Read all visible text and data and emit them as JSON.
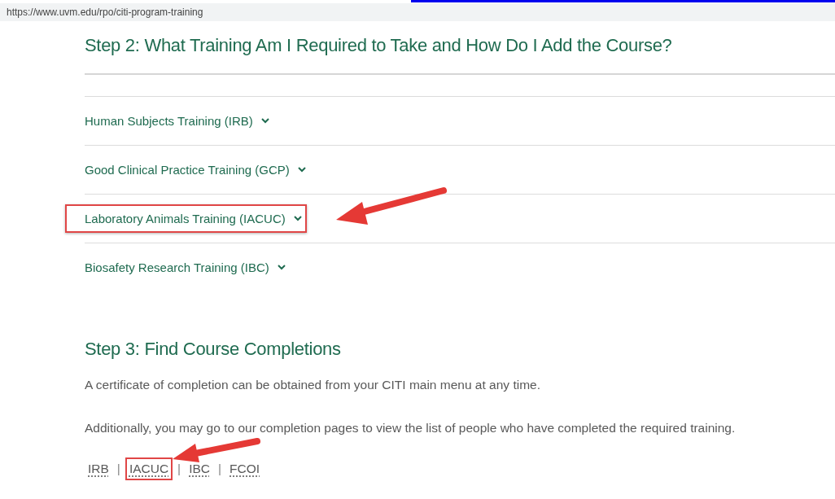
{
  "address_bar": {
    "url": "https://www.uvm.edu/rpo/citi-program-training"
  },
  "step2": {
    "heading": "Step 2: What Training Am I Required to Take and How Do I Add the Course?",
    "items": [
      {
        "label": "Human Subjects Training (IRB)",
        "expanded": false,
        "highlighted": false
      },
      {
        "label": "Good Clinical Practice Training (GCP)",
        "expanded": false,
        "highlighted": false
      },
      {
        "label": "Laboratory Animals Training (IACUC)",
        "expanded": false,
        "highlighted": true
      },
      {
        "label": "Biosafety Research Training (IBC)",
        "expanded": false,
        "highlighted": false
      }
    ]
  },
  "step3": {
    "heading": "Step 3: Find Course Completions",
    "paragraphs": [
      "A certificate of completion can be obtained from your CITI main menu at any time.",
      "Additionally, you may go to our completion pages to view the list of people who have completed the required training."
    ],
    "links": [
      {
        "label": "IRB",
        "highlighted": false
      },
      {
        "label": "IACUC",
        "highlighted": true
      },
      {
        "label": "IBC",
        "highlighted": false
      },
      {
        "label": "FCOI",
        "highlighted": false
      }
    ],
    "separator": "|"
  }
}
